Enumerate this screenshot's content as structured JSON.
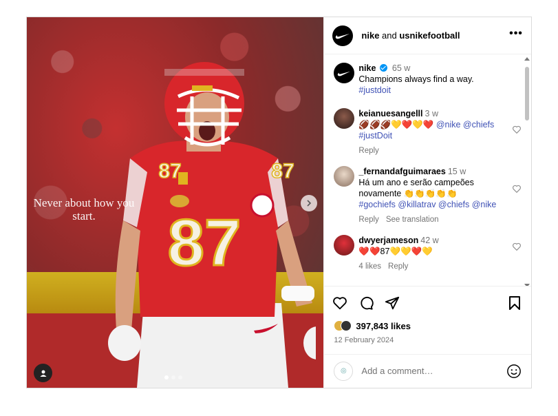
{
  "media": {
    "overlay_text": "Never about how you start.",
    "slide_count": 3,
    "active_slide": 1
  },
  "header": {
    "author": "nike",
    "connector": " and ",
    "collaborator": "usnikefootball",
    "more_icon": "more-horizontal-icon"
  },
  "caption": {
    "user": "nike",
    "verified": true,
    "time": "65 w",
    "text": "Champions always find a way.",
    "hashtag": "#justdoit"
  },
  "comments": [
    {
      "user": "keianuesangelll",
      "time": "3 w",
      "text": "🏈🏈🏈💛❤️💛❤️",
      "links": "@nike @chiefs #justDoit",
      "actions": [
        "Reply"
      ]
    },
    {
      "user": "_fernandafguimaraes",
      "time": "15 w",
      "text": "Há um ano e serão campeões novamente 👏👏👏👏👏",
      "links": "#gochiefs @killatrav @chiefs @nike",
      "actions": [
        "Reply",
        "See translation"
      ]
    },
    {
      "user": "dwyerjameson",
      "time": "42 w",
      "text": "❤️❤️87💛💛❤️💛",
      "links": "",
      "actions": [
        "4 likes",
        "Reply"
      ]
    }
  ],
  "actions": {
    "like_icon": "heart-icon",
    "comment_icon": "comment-icon",
    "share_icon": "share-icon",
    "save_icon": "bookmark-icon"
  },
  "likes": "397,843 likes",
  "date": "12 February 2024",
  "add_comment": {
    "placeholder": "Add a comment…",
    "emoji_icon": "emoji-icon"
  },
  "colors": {
    "link": "#3f51b5",
    "verified": "#0095f6",
    "muted": "#737373"
  }
}
